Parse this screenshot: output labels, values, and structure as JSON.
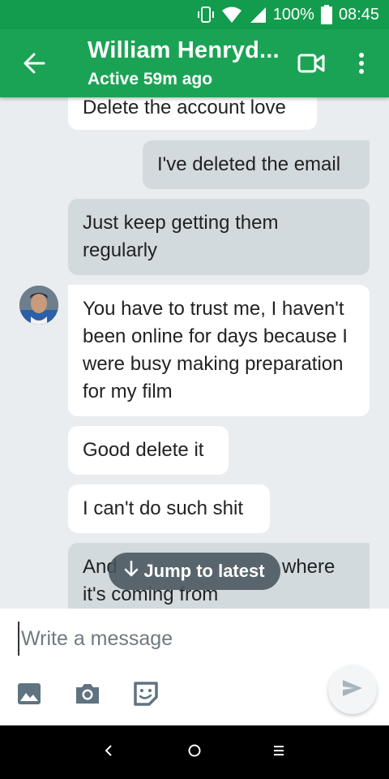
{
  "status_bar": {
    "battery_percent": "100%",
    "time": "08:45",
    "icons": [
      "vibrate-icon",
      "wifi-icon",
      "signal-icon",
      "battery-icon"
    ]
  },
  "header": {
    "contact_name": "William Henryd...",
    "status": "Active 59m ago",
    "icons": [
      "back-arrow-icon",
      "video-call-icon",
      "more-vertical-icon"
    ]
  },
  "messages": [
    {
      "direction": "incoming",
      "text": "Delete the account love"
    },
    {
      "direction": "outgoing",
      "text": "I've deleted the email"
    },
    {
      "direction": "outgoing",
      "text": "Just keep getting them regularly"
    },
    {
      "direction": "incoming",
      "text": "You have to trust me, I haven't been online for days because I were busy making preparation for my film"
    },
    {
      "direction": "incoming",
      "text": "Good delete it"
    },
    {
      "direction": "incoming",
      "text": "I can't do such shit"
    },
    {
      "direction": "outgoing",
      "text_before": "And",
      "text_after": "where",
      "text_line2": "it's coming from"
    }
  ],
  "jump_to_latest": {
    "label": "Jump to latest",
    "icon": "arrow-down-icon"
  },
  "composer": {
    "placeholder": "Write a message",
    "tools": [
      "gallery-icon",
      "camera-icon",
      "sticker-icon"
    ],
    "send_icon": "send-icon"
  },
  "nav_bar": {
    "icons": [
      "back-chevron-icon",
      "home-circle-icon",
      "menu-lines-icon"
    ]
  },
  "colors": {
    "header": "#1ba355",
    "status_bar": "#139c4e",
    "outgoing_bubble": "#d2dade",
    "background": "#e9edf0"
  }
}
